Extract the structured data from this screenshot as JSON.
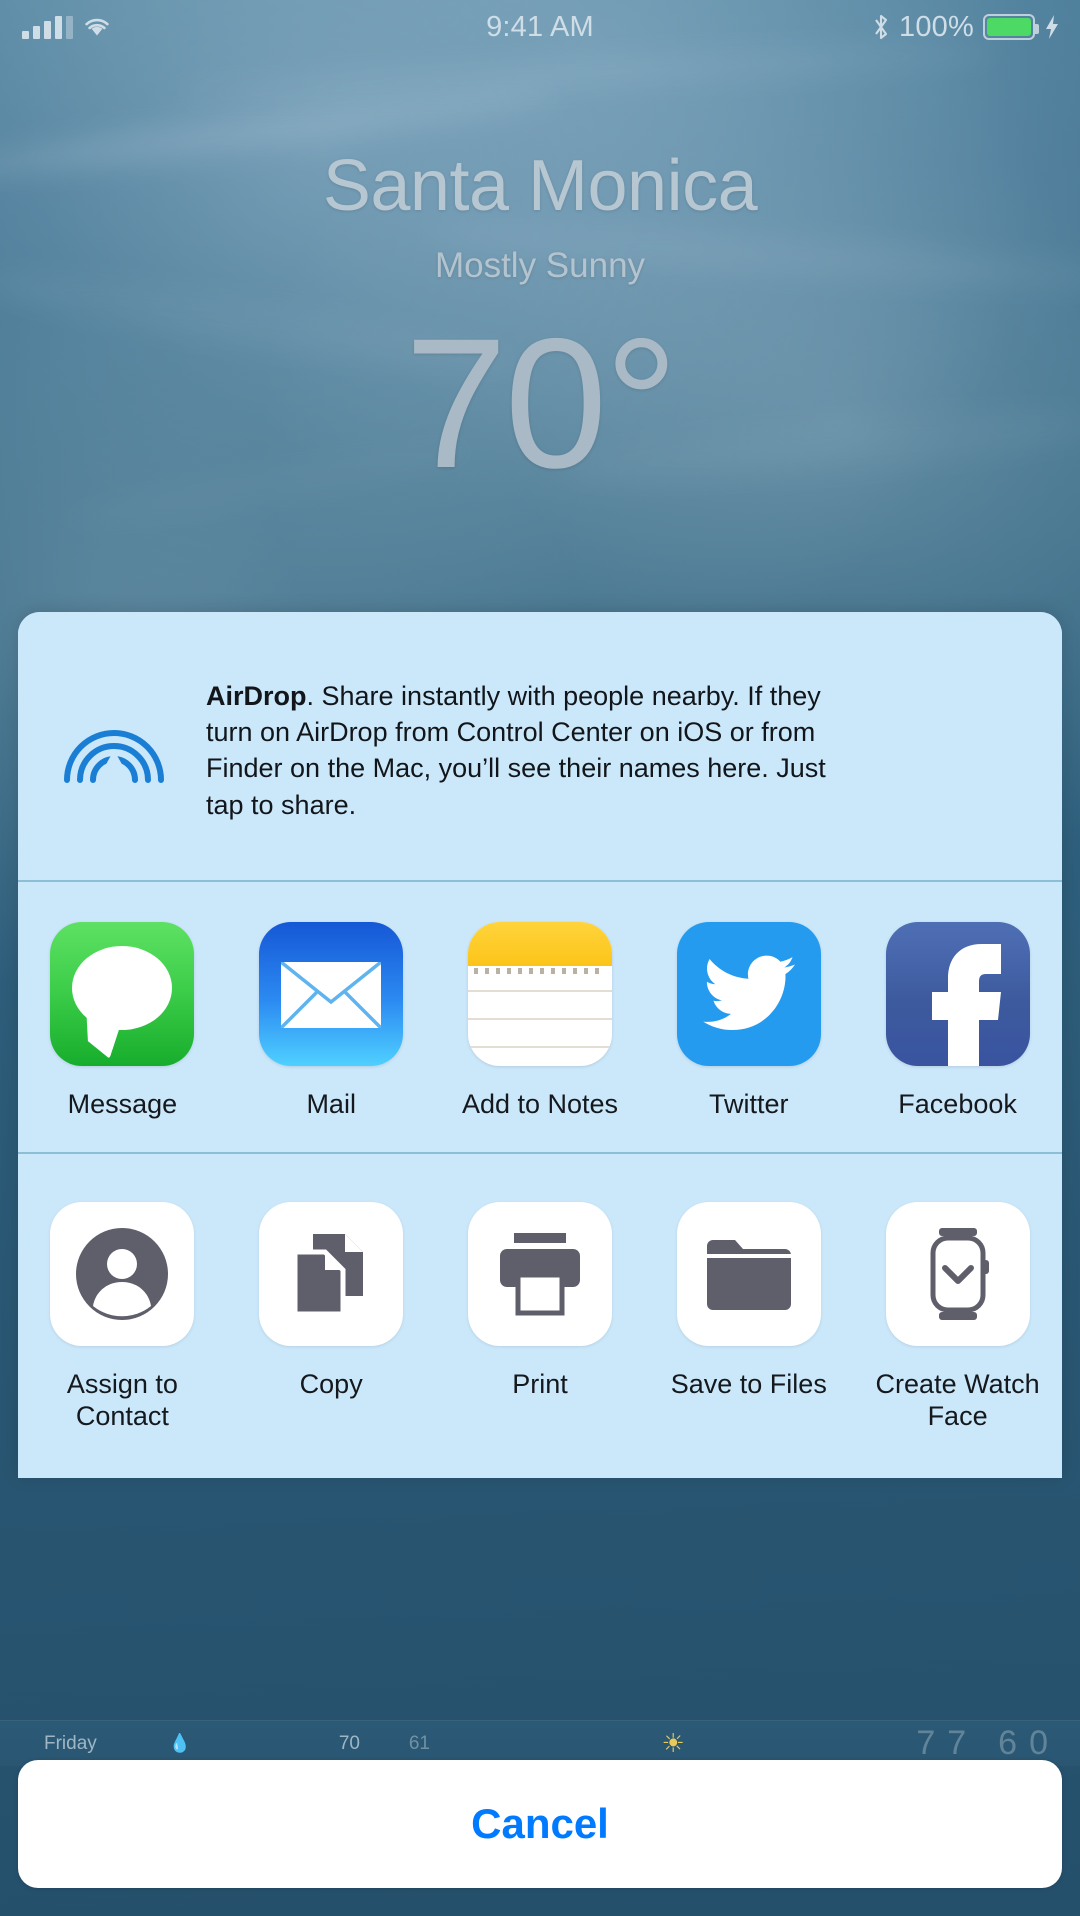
{
  "status_bar": {
    "time": "9:41 AM",
    "battery_percent": "100%",
    "signal_icon": "cellular-bars-icon",
    "wifi_icon": "wifi-icon",
    "bluetooth_icon": "bluetooth-icon",
    "battery_icon": "battery-icon",
    "charging_icon": "lightning-bolt-icon",
    "bluetooth_glyph": "ᛗ",
    "charging_glyph": "⚡"
  },
  "weather": {
    "city": "Santa Monica",
    "condition": "Mostly Sunny",
    "temperature": "70°",
    "forecast_row": {
      "day": "Friday",
      "precip_icon": "raindrop-icon",
      "precip_glyph": "Ὂ7",
      "high": "70",
      "low": "61",
      "sun_icon": "sun-icon",
      "next_high": "77",
      "next_low": "60"
    }
  },
  "share_sheet": {
    "airdrop": {
      "icon": "airdrop-icon",
      "title": "AirDrop",
      "body": ". Share instantly with people nearby. If they turn on AirDrop from Control Center on iOS or from Finder on the Mac, you’ll see their names here. Just tap to share."
    },
    "apps": [
      {
        "label": "Message",
        "icon": "messages-app-icon"
      },
      {
        "label": "Mail",
        "icon": "mail-app-icon"
      },
      {
        "label": "Add to Notes",
        "icon": "notes-app-icon"
      },
      {
        "label": "Twitter",
        "icon": "twitter-app-icon"
      },
      {
        "label": "Facebook",
        "icon": "facebook-app-icon"
      }
    ],
    "actions": [
      {
        "label": "Assign to Contact",
        "icon": "person-circle-icon"
      },
      {
        "label": "Copy",
        "icon": "copy-documents-icon"
      },
      {
        "label": "Print",
        "icon": "printer-icon"
      },
      {
        "label": "Save to Files",
        "icon": "folder-icon"
      },
      {
        "label": "Create Watch Face",
        "icon": "apple-watch-icon"
      }
    ],
    "cancel_label": "Cancel"
  },
  "colors": {
    "sheet_background": "#cbe8fb",
    "accent_blue": "#007aff",
    "airdrop_blue": "#1a7fd4",
    "divider": "#5a9ab8",
    "messages_green": "#3ccd49",
    "mail_blue": "#2c8bf2",
    "notes_yellow": "#fcc419",
    "twitter_blue": "#259bf0",
    "facebook_blue": "#3d5a9e",
    "action_glyph_gray": "#5f5f6b",
    "battery_green": "#4cd964"
  }
}
